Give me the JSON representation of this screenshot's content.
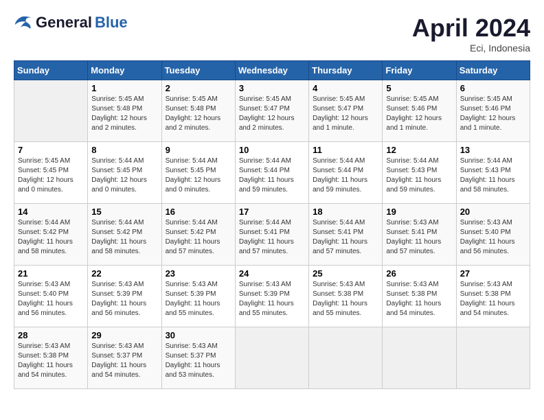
{
  "header": {
    "logo": {
      "general": "General",
      "blue": "Blue"
    },
    "title": "April 2024",
    "location": "Eci, Indonesia"
  },
  "calendar": {
    "days_of_week": [
      "Sunday",
      "Monday",
      "Tuesday",
      "Wednesday",
      "Thursday",
      "Friday",
      "Saturday"
    ],
    "weeks": [
      [
        {
          "day": "",
          "info": ""
        },
        {
          "day": "1",
          "info": "Sunrise: 5:45 AM\nSunset: 5:48 PM\nDaylight: 12 hours\nand 2 minutes."
        },
        {
          "day": "2",
          "info": "Sunrise: 5:45 AM\nSunset: 5:48 PM\nDaylight: 12 hours\nand 2 minutes."
        },
        {
          "day": "3",
          "info": "Sunrise: 5:45 AM\nSunset: 5:47 PM\nDaylight: 12 hours\nand 2 minutes."
        },
        {
          "day": "4",
          "info": "Sunrise: 5:45 AM\nSunset: 5:47 PM\nDaylight: 12 hours\nand 1 minute."
        },
        {
          "day": "5",
          "info": "Sunrise: 5:45 AM\nSunset: 5:46 PM\nDaylight: 12 hours\nand 1 minute."
        },
        {
          "day": "6",
          "info": "Sunrise: 5:45 AM\nSunset: 5:46 PM\nDaylight: 12 hours\nand 1 minute."
        }
      ],
      [
        {
          "day": "7",
          "info": "Sunrise: 5:45 AM\nSunset: 5:45 PM\nDaylight: 12 hours\nand 0 minutes."
        },
        {
          "day": "8",
          "info": "Sunrise: 5:44 AM\nSunset: 5:45 PM\nDaylight: 12 hours\nand 0 minutes."
        },
        {
          "day": "9",
          "info": "Sunrise: 5:44 AM\nSunset: 5:45 PM\nDaylight: 12 hours\nand 0 minutes."
        },
        {
          "day": "10",
          "info": "Sunrise: 5:44 AM\nSunset: 5:44 PM\nDaylight: 11 hours\nand 59 minutes."
        },
        {
          "day": "11",
          "info": "Sunrise: 5:44 AM\nSunset: 5:44 PM\nDaylight: 11 hours\nand 59 minutes."
        },
        {
          "day": "12",
          "info": "Sunrise: 5:44 AM\nSunset: 5:43 PM\nDaylight: 11 hours\nand 59 minutes."
        },
        {
          "day": "13",
          "info": "Sunrise: 5:44 AM\nSunset: 5:43 PM\nDaylight: 11 hours\nand 58 minutes."
        }
      ],
      [
        {
          "day": "14",
          "info": "Sunrise: 5:44 AM\nSunset: 5:42 PM\nDaylight: 11 hours\nand 58 minutes."
        },
        {
          "day": "15",
          "info": "Sunrise: 5:44 AM\nSunset: 5:42 PM\nDaylight: 11 hours\nand 58 minutes."
        },
        {
          "day": "16",
          "info": "Sunrise: 5:44 AM\nSunset: 5:42 PM\nDaylight: 11 hours\nand 57 minutes."
        },
        {
          "day": "17",
          "info": "Sunrise: 5:44 AM\nSunset: 5:41 PM\nDaylight: 11 hours\nand 57 minutes."
        },
        {
          "day": "18",
          "info": "Sunrise: 5:44 AM\nSunset: 5:41 PM\nDaylight: 11 hours\nand 57 minutes."
        },
        {
          "day": "19",
          "info": "Sunrise: 5:43 AM\nSunset: 5:41 PM\nDaylight: 11 hours\nand 57 minutes."
        },
        {
          "day": "20",
          "info": "Sunrise: 5:43 AM\nSunset: 5:40 PM\nDaylight: 11 hours\nand 56 minutes."
        }
      ],
      [
        {
          "day": "21",
          "info": "Sunrise: 5:43 AM\nSunset: 5:40 PM\nDaylight: 11 hours\nand 56 minutes."
        },
        {
          "day": "22",
          "info": "Sunrise: 5:43 AM\nSunset: 5:39 PM\nDaylight: 11 hours\nand 56 minutes."
        },
        {
          "day": "23",
          "info": "Sunrise: 5:43 AM\nSunset: 5:39 PM\nDaylight: 11 hours\nand 55 minutes."
        },
        {
          "day": "24",
          "info": "Sunrise: 5:43 AM\nSunset: 5:39 PM\nDaylight: 11 hours\nand 55 minutes."
        },
        {
          "day": "25",
          "info": "Sunrise: 5:43 AM\nSunset: 5:38 PM\nDaylight: 11 hours\nand 55 minutes."
        },
        {
          "day": "26",
          "info": "Sunrise: 5:43 AM\nSunset: 5:38 PM\nDaylight: 11 hours\nand 54 minutes."
        },
        {
          "day": "27",
          "info": "Sunrise: 5:43 AM\nSunset: 5:38 PM\nDaylight: 11 hours\nand 54 minutes."
        }
      ],
      [
        {
          "day": "28",
          "info": "Sunrise: 5:43 AM\nSunset: 5:38 PM\nDaylight: 11 hours\nand 54 minutes."
        },
        {
          "day": "29",
          "info": "Sunrise: 5:43 AM\nSunset: 5:37 PM\nDaylight: 11 hours\nand 54 minutes."
        },
        {
          "day": "30",
          "info": "Sunrise: 5:43 AM\nSunset: 5:37 PM\nDaylight: 11 hours\nand 53 minutes."
        },
        {
          "day": "",
          "info": ""
        },
        {
          "day": "",
          "info": ""
        },
        {
          "day": "",
          "info": ""
        },
        {
          "day": "",
          "info": ""
        }
      ]
    ]
  }
}
